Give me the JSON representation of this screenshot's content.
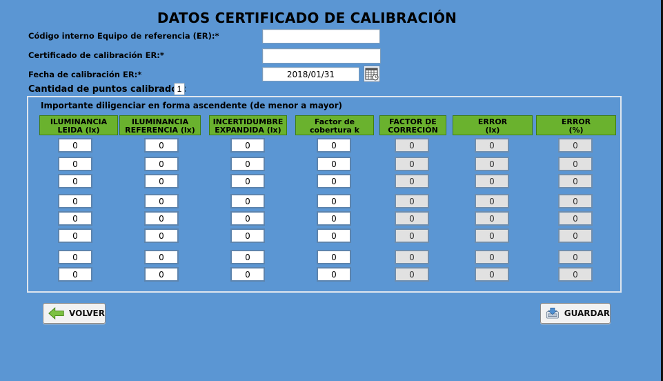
{
  "title": "DATOS CERTIFICADO DE CALIBRACIÓN",
  "fields": {
    "codigo_label": "Código interno Equipo de referencia (ER):*",
    "codigo_value": "",
    "certificado_label": "Certificado de calibración ER:*",
    "certificado_value": "",
    "fecha_label": "Fecha de calibración ER:*",
    "fecha_value": "2018/01/31"
  },
  "points": {
    "label": "Cantidad de puntos calibrados:",
    "value": "1"
  },
  "panel_note": "Importante diligenciar en forma ascendente (de menor a mayor)",
  "headers": [
    "ILUMINANCIA\nLEIDA (lx)",
    "ILUMINANCIA\nREFERENCIA (lx)",
    "INCERTIDUMBRE\nEXPANDIDA (lx)",
    "Factor de\ncobertura k",
    "FACTOR DE\nCORRECIÓN",
    "ERROR\n(lx)",
    "ERROR\n(%)"
  ],
  "rows": [
    [
      "0",
      "0",
      "0",
      "0",
      "0",
      "0",
      "0"
    ],
    [
      "0",
      "0",
      "0",
      "0",
      "0",
      "0",
      "0"
    ],
    [
      "0",
      "0",
      "0",
      "0",
      "0",
      "0",
      "0"
    ],
    [
      "0",
      "0",
      "0",
      "0",
      "0",
      "0",
      "0"
    ],
    [
      "0",
      "0",
      "0",
      "0",
      "0",
      "0",
      "0"
    ],
    [
      "0",
      "0",
      "0",
      "0",
      "0",
      "0",
      "0"
    ],
    [
      "0",
      "0",
      "0",
      "0",
      "0",
      "0",
      "0"
    ],
    [
      "0",
      "0",
      "0",
      "0",
      "0",
      "0",
      "0"
    ]
  ],
  "buttons": {
    "volver": "VOLVER",
    "guardar": "GUARDAR"
  },
  "icons": {
    "calendar": "calendar-icon",
    "back": "arrow-left-icon",
    "save": "save-icon"
  }
}
